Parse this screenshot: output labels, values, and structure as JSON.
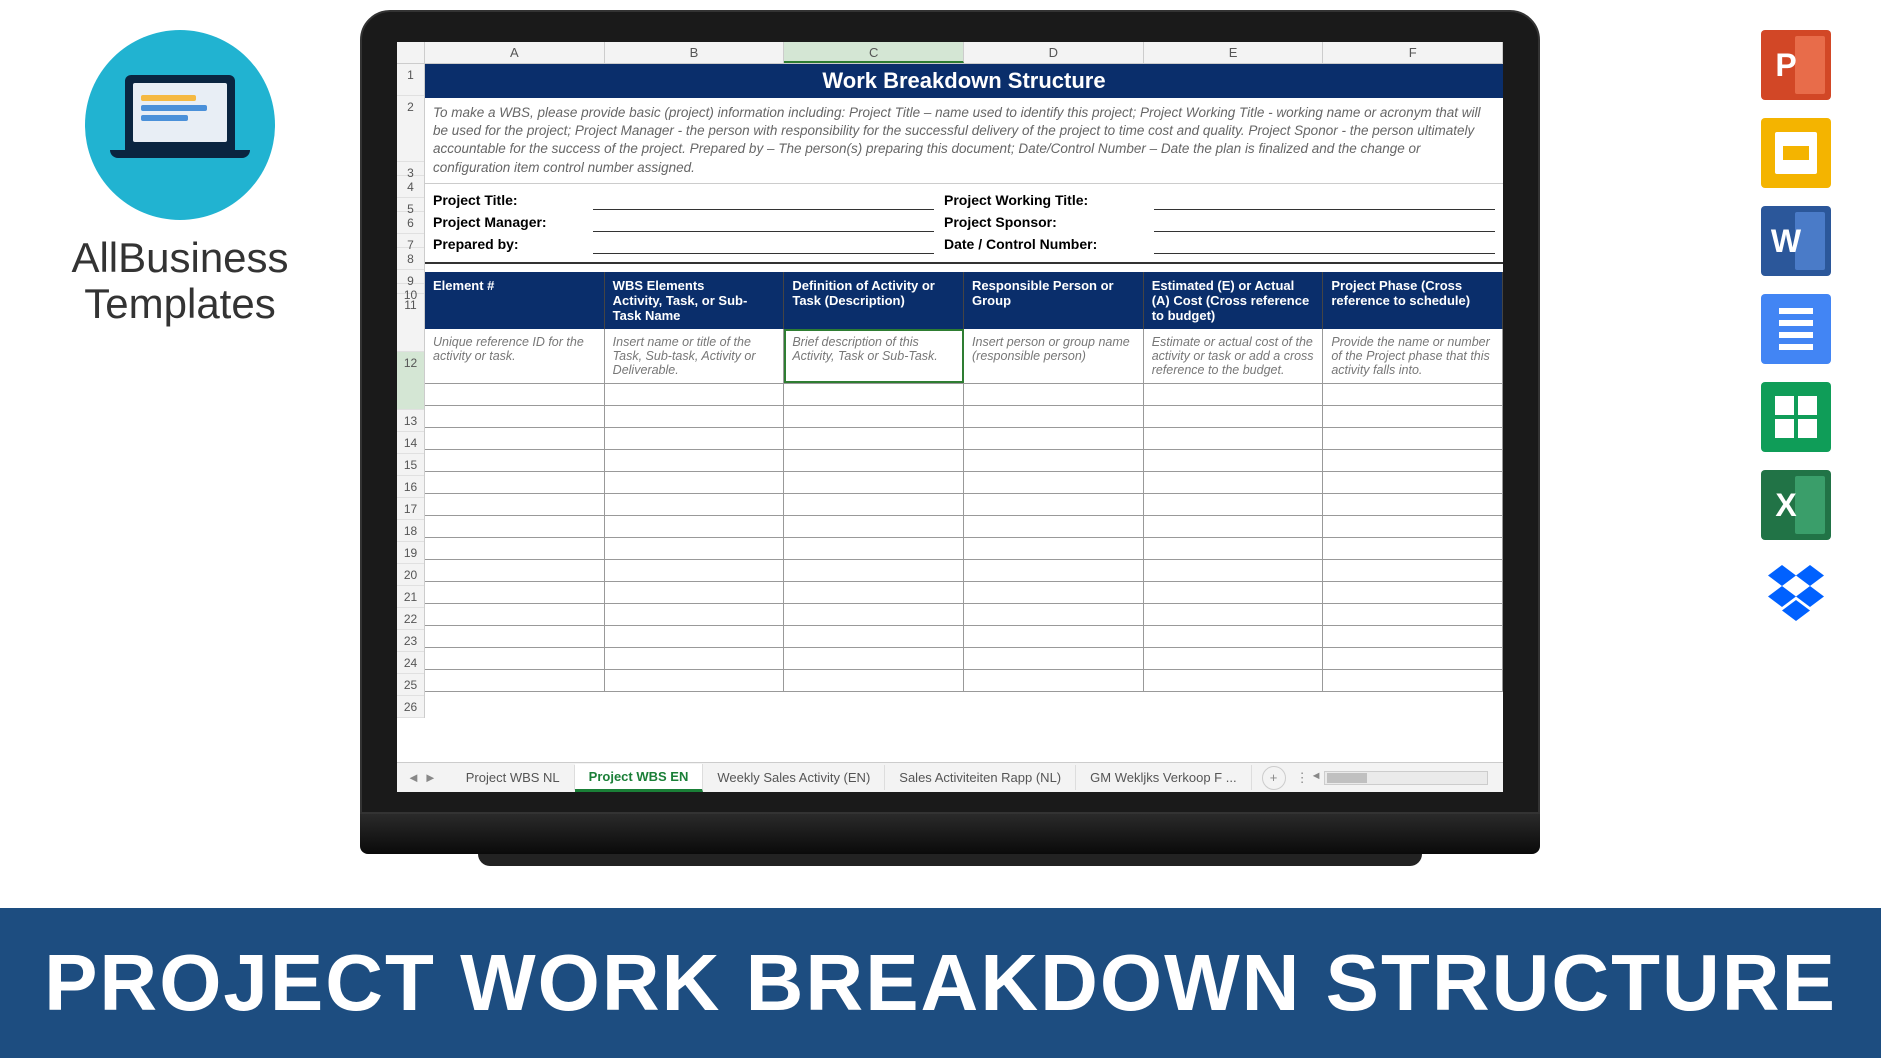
{
  "logo": {
    "line1": "AllBusiness",
    "line2": "Templates"
  },
  "banner_text": "PROJECT WORK BREAKDOWN STRUCTURE",
  "right_icons": {
    "powerpoint": "P",
    "word": "W",
    "excel": "X"
  },
  "spreadsheet": {
    "columns": [
      "A",
      "B",
      "C",
      "D",
      "E",
      "F"
    ],
    "row_numbers": [
      1,
      2,
      3,
      4,
      5,
      6,
      7,
      8,
      9,
      10,
      11,
      12,
      13,
      14,
      15,
      16,
      17,
      18,
      19,
      20,
      21,
      22,
      23,
      24,
      25,
      26
    ],
    "title": "Work Breakdown Structure",
    "instructions": "To make a WBS, please provide basic (project) information including: Project Title – name used to identify this project; Project Working Title - working name or acronym that will be used for the project; Project Manager - the person with responsibility for the successful delivery of the project to time cost and quality. Project Sponor - the person ultimately accountable for the success of the project. Prepared by – The person(s) preparing this document; Date/Control Number – Date the plan is finalized and the change or configuration item control number assigned.",
    "meta": {
      "project_title": "Project Title:",
      "project_working_title": "Project Working Title:",
      "project_manager": "Project Manager:",
      "project_sponsor": "Project Sponsor:",
      "prepared_by": "Prepared by:",
      "date_control": "Date / Control Number:"
    },
    "table_headers": [
      "Element #",
      "WBS Elements\nActivity, Task, or Sub-Task Name",
      "Definition of Activity or Task (Description)",
      "Responsible Person or Group",
      "Estimated (E) or Actual (A) Cost (Cross reference to budget)",
      "Project Phase (Cross reference to schedule)"
    ],
    "table_hints": [
      "Unique reference ID for the activity or task.",
      "Insert name or title of the Task, Sub-task, Activity or Deliverable.",
      "Brief description of this Activity, Task or Sub-Task.",
      "Insert person or group name (responsible person)",
      "Estimate or actual cost of the activity or task or add a cross reference to the budget.",
      "Provide the name or number of the Project phase that this activity falls into."
    ],
    "tabs": [
      "Project WBS NL",
      "Project WBS EN",
      "Weekly Sales Activity (EN)",
      "Sales Activiteiten Rapp (NL)",
      "GM Wekljks Verkoop F ..."
    ],
    "active_tab_index": 1
  }
}
